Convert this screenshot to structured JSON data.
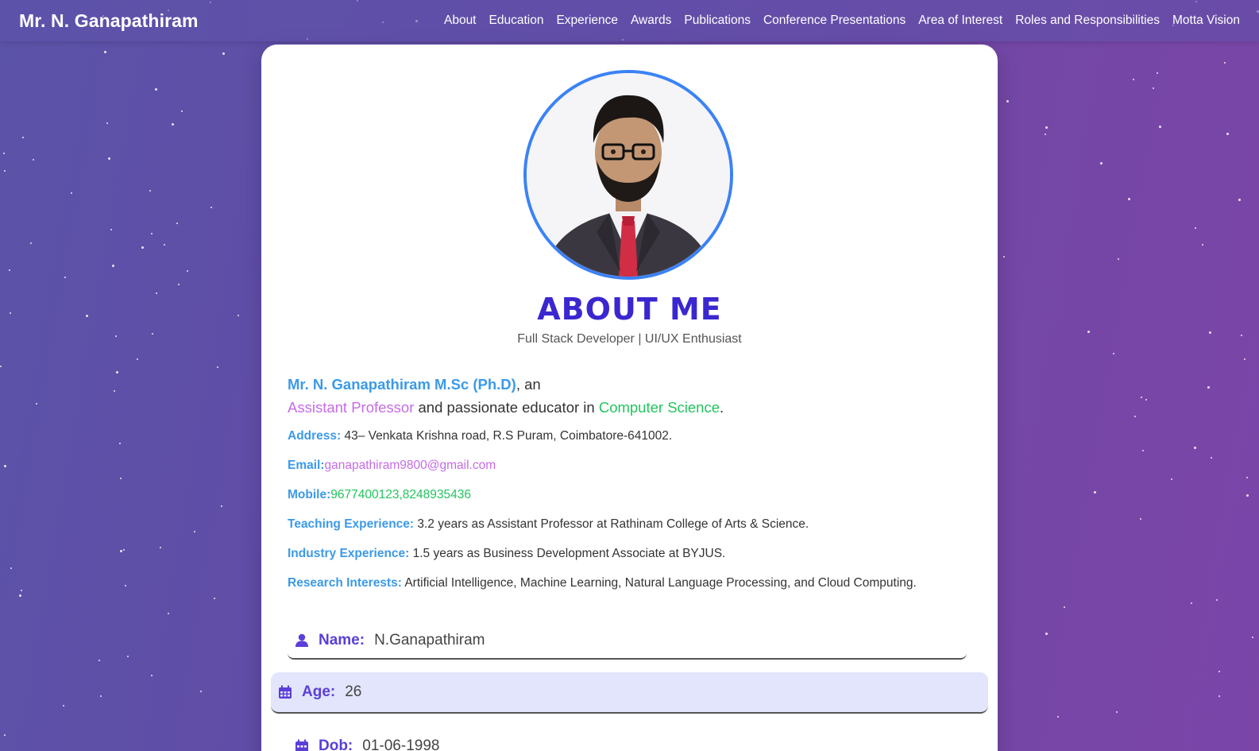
{
  "brand": "Mr. N. Ganapathiram",
  "nav": [
    "About",
    "Education",
    "Experience",
    "Awards",
    "Publications",
    "Conference Presentations",
    "Area of Interest",
    "Roles and Responsibilities",
    "Motta Vision"
  ],
  "about": {
    "title": "ABOUT ME",
    "tagline": "Full Stack Developer | UI/UX Enthusiast",
    "intro": {
      "name": "Mr. N. Ganapathiram M.Sc (Ph.D)",
      "after_name": ", an",
      "role": "Assistant Professor",
      "mid": " and passionate educator in ",
      "field": "Computer Science",
      "end": "."
    },
    "address_label": "Address:",
    "address": " 43– Venkata Krishna road, R.S Puram, Coimbatore-641002.",
    "email_label": "Email:",
    "email": "ganapathiram9800@gmail.com",
    "mobile_label": "Mobile:",
    "mobile": "9677400123,8248935436",
    "teaching_label": "Teaching Experience:",
    "teaching": " 3.2 years as Assistant Professor at Rathinam College of Arts & Science.",
    "industry_label": "Industry Experience:",
    "industry": " 1.5 years as Business Development Associate at BYJUS.",
    "research_label": "Research Interests:",
    "research": " Artificial Intelligence, Machine Learning, Natural Language Processing, and Cloud Computing."
  },
  "fields": {
    "name_label": "Name:",
    "name_value": "N.Ganapathiram",
    "age_label": "Age:",
    "age_value": "26",
    "dob_label": "Dob:",
    "dob_value": "01-06-1998"
  },
  "colors": {
    "accent_title": "#3b27d0",
    "label_blue": "#3b9ae8",
    "violet": "#c66be6",
    "green": "#22c55e",
    "avatar_border": "#3b82f6"
  },
  "icons": [
    "user-icon",
    "calendar-icon"
  ]
}
